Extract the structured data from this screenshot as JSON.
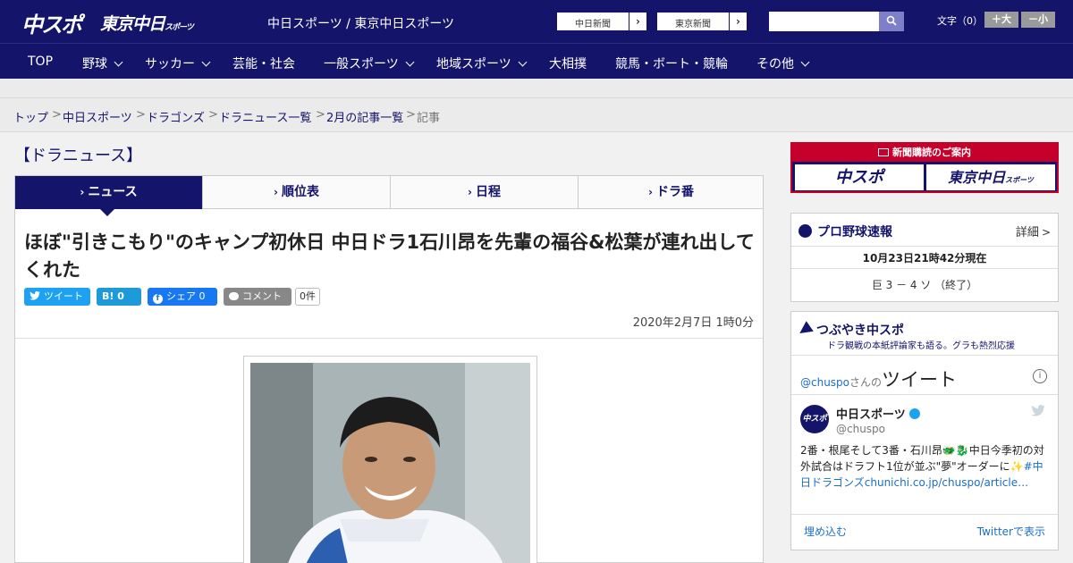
{
  "header": {
    "logo_main": "中スポ",
    "logo_tokyo": "東京中日",
    "logo_tokyo_sub": "スポーツ",
    "site_title": "中日スポーツ / 東京中日スポーツ",
    "btn_chunichi": "中日新聞",
    "btn_tokyo": "東京新聞",
    "search_placeholder": "",
    "fontsize_label": "文字（0）",
    "font_larger": "＋大",
    "font_smaller": "－小"
  },
  "nav": {
    "items": [
      {
        "label": "TOP"
      },
      {
        "label": "野球"
      },
      {
        "label": "サッカー"
      },
      {
        "label": "芸能・社会"
      },
      {
        "label": "一般スポーツ"
      },
      {
        "label": "地域スポーツ"
      },
      {
        "label": "大相撲"
      },
      {
        "label": "競馬・ボート・競輪"
      },
      {
        "label": "その他"
      }
    ]
  },
  "breadcrumbs": [
    "トップ",
    "中日スポーツ",
    "ドラゴンズ",
    "ドラニュース一覧",
    "2月の記事一覧",
    "記事"
  ],
  "section_title": "【ドラニュース】",
  "tabs": [
    {
      "label": "ニュース",
      "active": true
    },
    {
      "label": "順位表",
      "active": false
    },
    {
      "label": "日程",
      "active": false
    },
    {
      "label": "ドラ番",
      "active": false
    }
  ],
  "article": {
    "headline": "ほぼ\"引きこもり\"のキャンプ初休日 中日ドラ1石川昂を先輩の福谷&松葉が連れ出してくれた",
    "share": {
      "tweet": "ツイート",
      "hatena": "B! 0",
      "facebook": "シェア 0",
      "comment": "コメント",
      "comment_count": "0件"
    },
    "date": "2020年2月7日 1時0分"
  },
  "sidebar": {
    "ad": {
      "head": "新聞購読のご案内",
      "logo1": "中スポ",
      "logo2": "東京中日",
      "logo2_sub": "スポーツ"
    },
    "baseball": {
      "title": "プロ野球速報",
      "detail": "詳細",
      "timestamp": "10月23日21時42分現在",
      "score": "巨 3 － 4 ソ （終了）"
    },
    "tweets": {
      "title": "つぶやき中スポ",
      "subtitle": "ドラ観戦の本紙評論家も語る。グラも熱烈応援",
      "handle": "@chuspo",
      "handle_suffix": "さんの",
      "handle_big": "ツイート",
      "info": "i",
      "account_name": "中日スポーツ",
      "account_user": "@chuspo",
      "avatar_text": "中スポ",
      "text": "2番・根尾そして3番・石川昂🐲🐉中日今季初の対外試合はドラフト1位が並ぶ\"夢\"オーダーに✨",
      "text_link": "#中日ドラゴンズchunichi.co.jp/chuspo/article…",
      "embed": "埋め込む",
      "view_on_twitter": "Twitterで表示"
    }
  }
}
